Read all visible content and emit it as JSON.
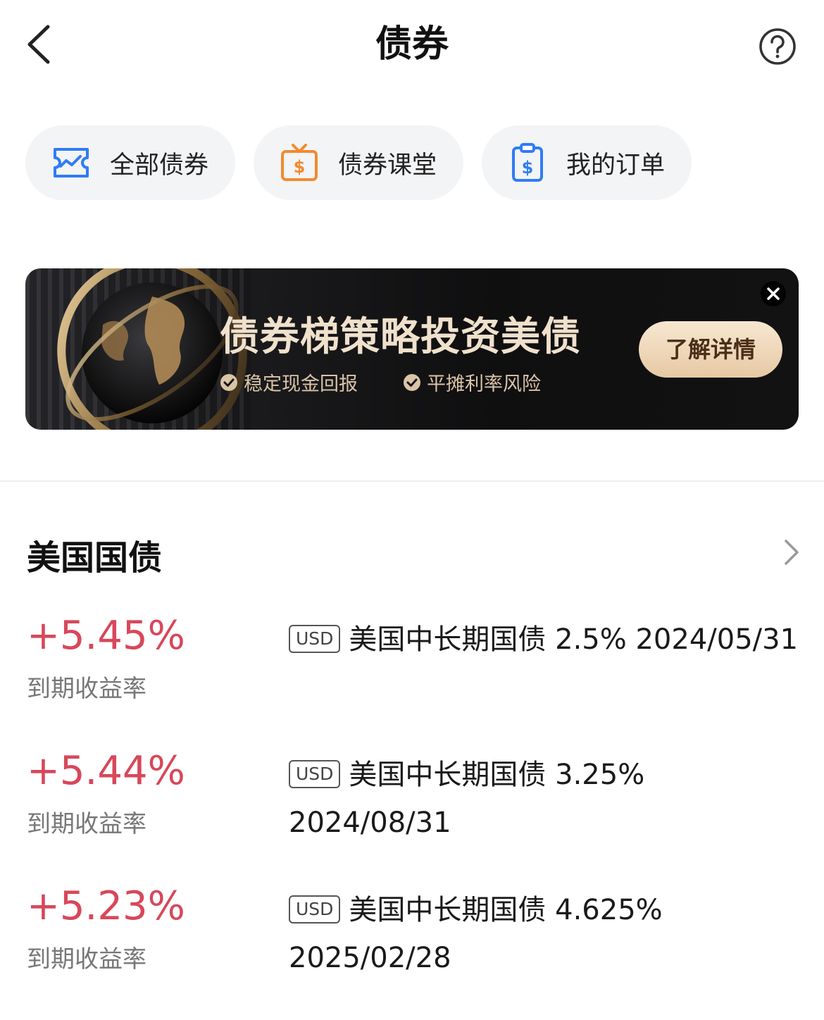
{
  "header": {
    "title": "债券",
    "back_icon": "chevron-left-icon",
    "help_icon": "question-circle-icon"
  },
  "quick_entries": [
    {
      "label": "全部债券",
      "icon": "chart-ticket-icon",
      "color": "#2f7cf6"
    },
    {
      "label": "债券课堂",
      "icon": "tv-dollar-icon",
      "color": "#f28a2e"
    },
    {
      "label": "我的订单",
      "icon": "clipboard-dollar-icon",
      "color": "#2f7cf6"
    }
  ],
  "banner": {
    "title": "债券梯策略投资美债",
    "features": [
      "稳定现金回报",
      "平摊利率风险"
    ],
    "cta": "了解详情",
    "close_icon": "close-icon",
    "accent": "#e7c9a4"
  },
  "section": {
    "title": "美国国债",
    "more_icon": "chevron-right-icon",
    "bonds": [
      {
        "yield": "+5.45%",
        "yield_label": "到期收益率",
        "currency": "USD",
        "name": "美国中长期国债 2.5% 2024/05/31"
      },
      {
        "yield": "+5.44%",
        "yield_label": "到期收益率",
        "currency": "USD",
        "name": "美国中长期国债 3.25% 2024/08/31"
      },
      {
        "yield": "+5.23%",
        "yield_label": "到期收益率",
        "currency": "USD",
        "name": "美国中长期国债 4.625% 2025/02/28"
      }
    ]
  },
  "colors": {
    "positive": "#d8475a",
    "muted": "#777777"
  }
}
